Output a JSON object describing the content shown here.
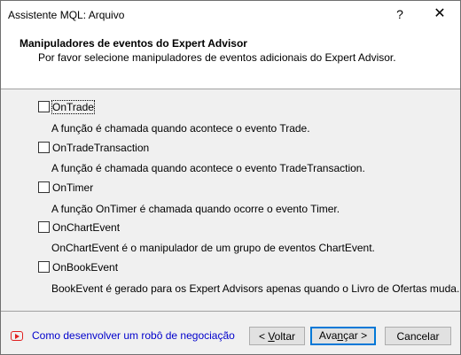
{
  "window": {
    "title": "Assistente MQL: Arquivo",
    "help_glyph": "?",
    "close_glyph": "✕"
  },
  "header": {
    "title": "Manipuladores de eventos do Expert Advisor",
    "subtitle": "Por favor selecione manipuladores de eventos adicionais do Expert Advisor."
  },
  "events": [
    {
      "label": "OnTrade",
      "checked": false,
      "description": "A função é chamada quando acontece o evento Trade."
    },
    {
      "label": "OnTradeTransaction",
      "checked": false,
      "description": "A função é chamada quando acontece o evento TradeTransaction."
    },
    {
      "label": "OnTimer",
      "checked": false,
      "description": "A função OnTimer é chamada quando ocorre o evento Timer."
    },
    {
      "label": "OnChartEvent",
      "checked": false,
      "description": "OnChartEvent é o manipulador de um grupo de eventos ChartEvent."
    },
    {
      "label": "OnBookEvent",
      "checked": false,
      "description": "BookEvent é gerado para os Expert Advisors apenas quando o Livro de Ofertas muda."
    }
  ],
  "footer": {
    "help_link": "Como desenvolver um robô de negociação",
    "back": {
      "prefix": "< ",
      "mnemonic": "V",
      "rest": "oltar"
    },
    "next": {
      "prefix": "Ava",
      "mnemonic": "n",
      "rest": "çar >"
    },
    "cancel": "Cancelar"
  }
}
